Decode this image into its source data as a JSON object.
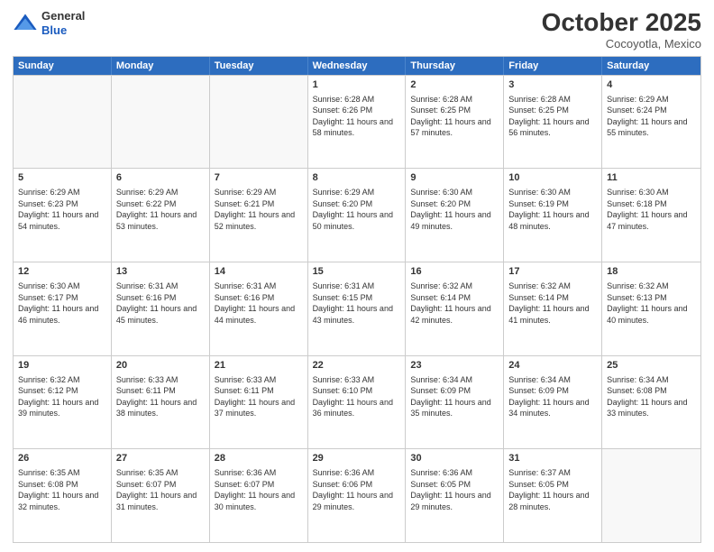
{
  "header": {
    "logo_line1": "General",
    "logo_line2": "Blue",
    "month": "October 2025",
    "location": "Cocoyotla, Mexico"
  },
  "days": [
    "Sunday",
    "Monday",
    "Tuesday",
    "Wednesday",
    "Thursday",
    "Friday",
    "Saturday"
  ],
  "weeks": [
    [
      {
        "num": "",
        "empty": true
      },
      {
        "num": "",
        "empty": true
      },
      {
        "num": "",
        "empty": true
      },
      {
        "num": "1",
        "sunrise": "6:28 AM",
        "sunset": "6:26 PM",
        "daylight": "11 hours and 58 minutes."
      },
      {
        "num": "2",
        "sunrise": "6:28 AM",
        "sunset": "6:25 PM",
        "daylight": "11 hours and 57 minutes."
      },
      {
        "num": "3",
        "sunrise": "6:28 AM",
        "sunset": "6:25 PM",
        "daylight": "11 hours and 56 minutes."
      },
      {
        "num": "4",
        "sunrise": "6:29 AM",
        "sunset": "6:24 PM",
        "daylight": "11 hours and 55 minutes."
      }
    ],
    [
      {
        "num": "5",
        "sunrise": "6:29 AM",
        "sunset": "6:23 PM",
        "daylight": "11 hours and 54 minutes."
      },
      {
        "num": "6",
        "sunrise": "6:29 AM",
        "sunset": "6:22 PM",
        "daylight": "11 hours and 53 minutes."
      },
      {
        "num": "7",
        "sunrise": "6:29 AM",
        "sunset": "6:21 PM",
        "daylight": "11 hours and 52 minutes."
      },
      {
        "num": "8",
        "sunrise": "6:29 AM",
        "sunset": "6:20 PM",
        "daylight": "11 hours and 50 minutes."
      },
      {
        "num": "9",
        "sunrise": "6:30 AM",
        "sunset": "6:20 PM",
        "daylight": "11 hours and 49 minutes."
      },
      {
        "num": "10",
        "sunrise": "6:30 AM",
        "sunset": "6:19 PM",
        "daylight": "11 hours and 48 minutes."
      },
      {
        "num": "11",
        "sunrise": "6:30 AM",
        "sunset": "6:18 PM",
        "daylight": "11 hours and 47 minutes."
      }
    ],
    [
      {
        "num": "12",
        "sunrise": "6:30 AM",
        "sunset": "6:17 PM",
        "daylight": "11 hours and 46 minutes."
      },
      {
        "num": "13",
        "sunrise": "6:31 AM",
        "sunset": "6:16 PM",
        "daylight": "11 hours and 45 minutes."
      },
      {
        "num": "14",
        "sunrise": "6:31 AM",
        "sunset": "6:16 PM",
        "daylight": "11 hours and 44 minutes."
      },
      {
        "num": "15",
        "sunrise": "6:31 AM",
        "sunset": "6:15 PM",
        "daylight": "11 hours and 43 minutes."
      },
      {
        "num": "16",
        "sunrise": "6:32 AM",
        "sunset": "6:14 PM",
        "daylight": "11 hours and 42 minutes."
      },
      {
        "num": "17",
        "sunrise": "6:32 AM",
        "sunset": "6:14 PM",
        "daylight": "11 hours and 41 minutes."
      },
      {
        "num": "18",
        "sunrise": "6:32 AM",
        "sunset": "6:13 PM",
        "daylight": "11 hours and 40 minutes."
      }
    ],
    [
      {
        "num": "19",
        "sunrise": "6:32 AM",
        "sunset": "6:12 PM",
        "daylight": "11 hours and 39 minutes."
      },
      {
        "num": "20",
        "sunrise": "6:33 AM",
        "sunset": "6:11 PM",
        "daylight": "11 hours and 38 minutes."
      },
      {
        "num": "21",
        "sunrise": "6:33 AM",
        "sunset": "6:11 PM",
        "daylight": "11 hours and 37 minutes."
      },
      {
        "num": "22",
        "sunrise": "6:33 AM",
        "sunset": "6:10 PM",
        "daylight": "11 hours and 36 minutes."
      },
      {
        "num": "23",
        "sunrise": "6:34 AM",
        "sunset": "6:09 PM",
        "daylight": "11 hours and 35 minutes."
      },
      {
        "num": "24",
        "sunrise": "6:34 AM",
        "sunset": "6:09 PM",
        "daylight": "11 hours and 34 minutes."
      },
      {
        "num": "25",
        "sunrise": "6:34 AM",
        "sunset": "6:08 PM",
        "daylight": "11 hours and 33 minutes."
      }
    ],
    [
      {
        "num": "26",
        "sunrise": "6:35 AM",
        "sunset": "6:08 PM",
        "daylight": "11 hours and 32 minutes."
      },
      {
        "num": "27",
        "sunrise": "6:35 AM",
        "sunset": "6:07 PM",
        "daylight": "11 hours and 31 minutes."
      },
      {
        "num": "28",
        "sunrise": "6:36 AM",
        "sunset": "6:07 PM",
        "daylight": "11 hours and 30 minutes."
      },
      {
        "num": "29",
        "sunrise": "6:36 AM",
        "sunset": "6:06 PM",
        "daylight": "11 hours and 29 minutes."
      },
      {
        "num": "30",
        "sunrise": "6:36 AM",
        "sunset": "6:05 PM",
        "daylight": "11 hours and 29 minutes."
      },
      {
        "num": "31",
        "sunrise": "6:37 AM",
        "sunset": "6:05 PM",
        "daylight": "11 hours and 28 minutes."
      },
      {
        "num": "",
        "empty": true
      }
    ]
  ]
}
